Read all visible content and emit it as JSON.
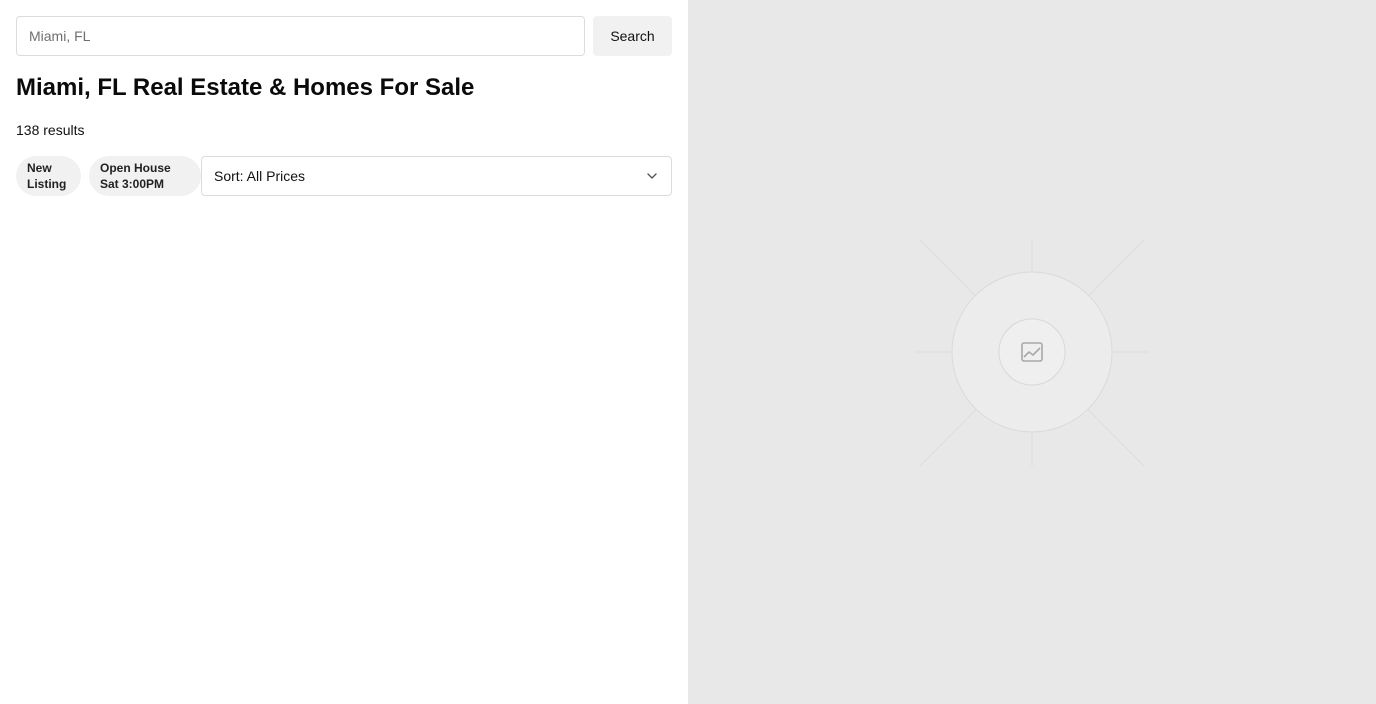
{
  "search": {
    "placeholder": "Miami, FL",
    "value": "",
    "button_label": "Search"
  },
  "header": {
    "title": "Miami, FL Real Estate & Homes For Sale",
    "results": "138 results"
  },
  "filters": {
    "chips": [
      {
        "line1": "New",
        "line2": "Listing"
      },
      {
        "line1": "Open House",
        "line2": "Sat 3:00PM"
      }
    ],
    "sort_label": "Sort: All Prices"
  },
  "map": {
    "icon": "image-placeholder-icon",
    "background": "#e8e8e8"
  },
  "colors": {
    "chip_bg": "#f1f1f1",
    "border": "#dcdcdc",
    "text": "#111111"
  }
}
